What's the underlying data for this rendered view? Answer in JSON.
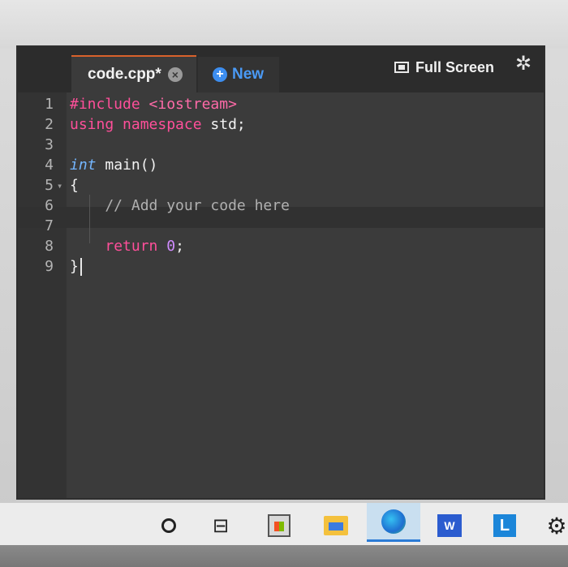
{
  "tabs": {
    "active": {
      "title": "code.cpp*",
      "close_icon": "close-icon"
    },
    "new": {
      "label": "New",
      "icon": "plus-circle-icon"
    }
  },
  "toolbar": {
    "fullscreen_label": "Full Screen",
    "fullscreen_icon": "fullscreen-icon",
    "settings_icon": "gear-icon"
  },
  "editor": {
    "lines": [
      {
        "number": "1",
        "tokens": [
          {
            "text": "#include ",
            "cls": "pink"
          },
          {
            "text": "<iostream>",
            "cls": "str"
          }
        ]
      },
      {
        "number": "2",
        "tokens": [
          {
            "text": "using namespace",
            "cls": "pink"
          },
          {
            "text": " std;",
            "cls": ""
          }
        ]
      },
      {
        "number": "3",
        "tokens": []
      },
      {
        "number": "4",
        "tokens": [
          {
            "text": "int",
            "cls": "kw-int"
          },
          {
            "text": " main()",
            "cls": ""
          }
        ]
      },
      {
        "number": "5",
        "fold": true,
        "tokens": [
          {
            "text": "{",
            "cls": ""
          }
        ]
      },
      {
        "number": "6",
        "tokens": [
          {
            "text": "    // Add your code here",
            "cls": "comment"
          }
        ]
      },
      {
        "number": "7",
        "tokens": []
      },
      {
        "number": "8",
        "tokens": [
          {
            "text": "    ",
            "cls": ""
          },
          {
            "text": "return",
            "cls": "pink"
          },
          {
            "text": " ",
            "cls": ""
          },
          {
            "text": "0",
            "cls": "num"
          },
          {
            "text": ";",
            "cls": ""
          }
        ]
      },
      {
        "number": "9",
        "cursor": true,
        "tokens": [
          {
            "text": "}",
            "cls": ""
          }
        ]
      }
    ],
    "active_line": "9"
  },
  "taskbar": {
    "items": [
      "cortana-icon",
      "task-view-icon",
      "store-icon",
      "file-explorer-icon",
      "edge-icon",
      "word-icon",
      "l-app-icon",
      "settings-icon"
    ],
    "word_label": "W",
    "l_label": "L"
  },
  "colors": {
    "editor_bg": "#3b3b3b",
    "keyword_pink": "#ff4f9a",
    "type_blue": "#74b6ff",
    "number_purple": "#d08cff",
    "accent_blue": "#3d8ef0",
    "tab_accent": "#d9622b"
  }
}
